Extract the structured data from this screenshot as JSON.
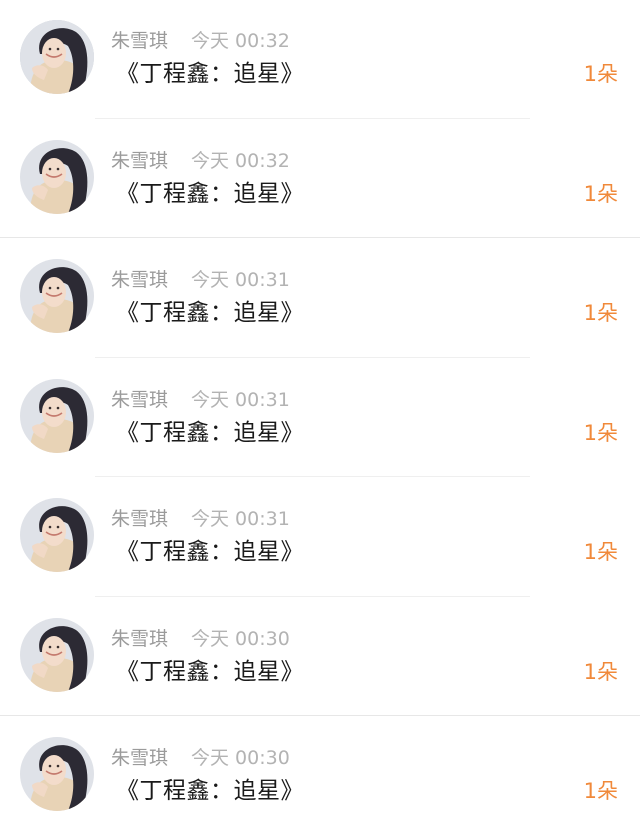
{
  "accent_color": "#f0893a",
  "avatar_icon": "user-photo-avatar",
  "items": [
    {
      "name": "朱雪琪",
      "time": "今天 00:32",
      "message": "《丁程鑫：追星》",
      "count": "1朵"
    },
    {
      "name": "朱雪琪",
      "time": "今天 00:32",
      "message": "《丁程鑫：追星》",
      "count": "1朵"
    },
    {
      "name": "朱雪琪",
      "time": "今天 00:31",
      "message": "《丁程鑫：追星》",
      "count": "1朵"
    },
    {
      "name": "朱雪琪",
      "time": "今天 00:31",
      "message": "《丁程鑫：追星》",
      "count": "1朵"
    },
    {
      "name": "朱雪琪",
      "time": "今天 00:31",
      "message": "《丁程鑫：追星》",
      "count": "1朵"
    },
    {
      "name": "朱雪琪",
      "time": "今天 00:30",
      "message": "《丁程鑫：追星》",
      "count": "1朵"
    },
    {
      "name": "朱雪琪",
      "time": "今天 00:30",
      "message": "《丁程鑫：追星》",
      "count": "1朵"
    }
  ]
}
